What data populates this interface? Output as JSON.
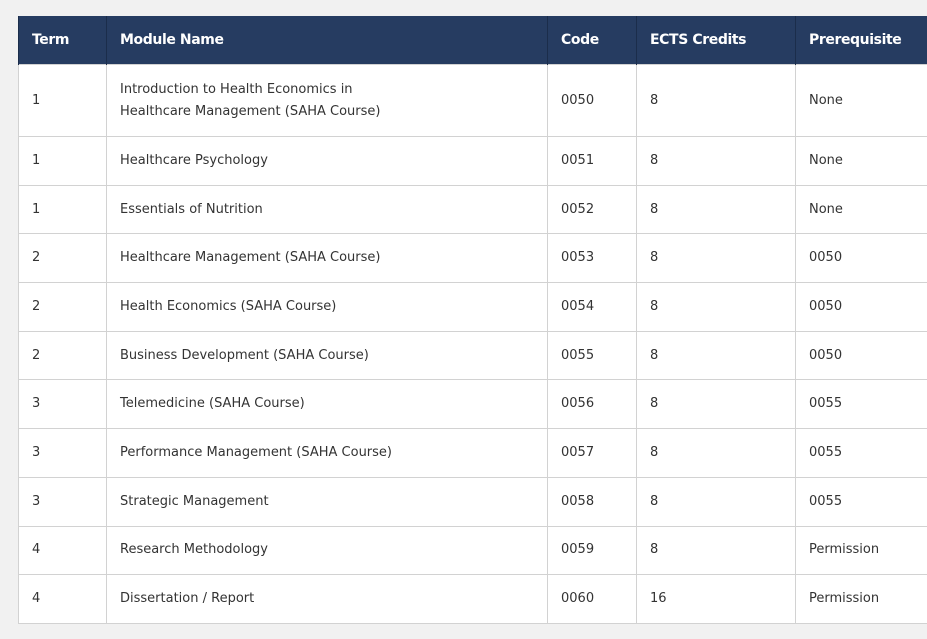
{
  "table": {
    "headers": [
      "Term",
      "Module Name",
      "Code",
      "ECTS Credits",
      "Prerequisite"
    ],
    "rows": [
      {
        "term": "1",
        "name_line1": "Introduction to Health Economics in",
        "name_line2": "Healthcare Management (SAHA Course)",
        "code": "0050",
        "ects": "8",
        "prereq": "None"
      },
      {
        "term": "1",
        "name": "Healthcare Psychology",
        "code": "0051",
        "ects": "8",
        "prereq": "None"
      },
      {
        "term": "1",
        "name": "Essentials of Nutrition",
        "code": "0052",
        "ects": "8",
        "prereq": "None"
      },
      {
        "term": "2",
        "name": "Healthcare Management (SAHA Course)",
        "code": "0053",
        "ects": "8",
        "prereq": "0050"
      },
      {
        "term": "2",
        "name": "Health Economics (SAHA Course)",
        "code": "0054",
        "ects": "8",
        "prereq": "0050"
      },
      {
        "term": "2",
        "name": "Business Development (SAHA Course)",
        "code": "0055",
        "ects": "8",
        "prereq": "0050"
      },
      {
        "term": "3",
        "name": "Telemedicine (SAHA Course)",
        "code": "0056",
        "ects": "8",
        "prereq": "0055"
      },
      {
        "term": "3",
        "name": "Performance Management (SAHA Course)",
        "code": "0057",
        "ects": "8",
        "prereq": "0055"
      },
      {
        "term": "3",
        "name": "Strategic Management",
        "code": "0058",
        "ects": "8",
        "prereq": "0055"
      },
      {
        "term": "4",
        "name": "Research Methodology",
        "code": "0059",
        "ects": "8",
        "prereq": "Permission"
      },
      {
        "term": "4",
        "name": "Dissertation / Report",
        "code": "0060",
        "ects": "16",
        "prereq": "Permission"
      }
    ]
  }
}
